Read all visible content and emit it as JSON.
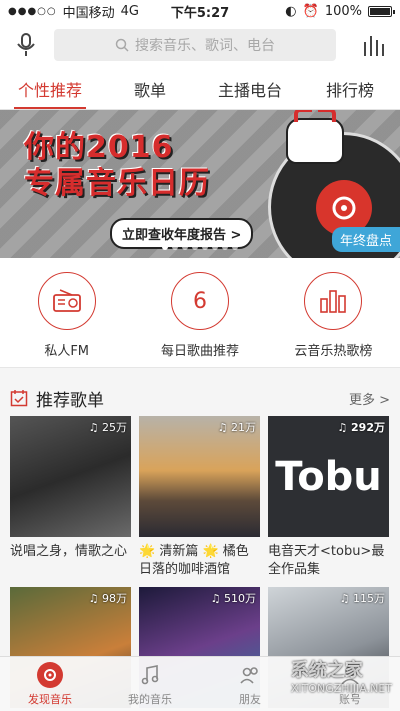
{
  "status": {
    "carrier": "中国移动",
    "network": "4G",
    "time": "下午5:27",
    "battery": "100%"
  },
  "search": {
    "placeholder": "搜索音乐、歌词、电台"
  },
  "tabs": [
    {
      "label": "个性推荐"
    },
    {
      "label": "歌单"
    },
    {
      "label": "主播电台"
    },
    {
      "label": "排行榜"
    }
  ],
  "banner": {
    "line1": "你的2016",
    "line2": "专属音乐日历",
    "button": "立即查收年度报告 >",
    "badge": "年终盘点"
  },
  "quick": [
    {
      "label": "私人FM",
      "icon": "radio-icon"
    },
    {
      "label": "每日歌曲推荐",
      "value": "6",
      "icon": "calendar-icon"
    },
    {
      "label": "云音乐热歌榜",
      "icon": "bar-chart-icon"
    }
  ],
  "section": {
    "title": "推荐歌单",
    "more": "更多 >"
  },
  "playlists": [
    {
      "count": "25万",
      "title": "说唱之身，情歌之心"
    },
    {
      "count": "21万",
      "title": "🌟 清新篇 🌟 橘色日落的咖啡酒馆"
    },
    {
      "count": "292万",
      "title": "电音天才<tobu>最全作品集",
      "cover_text": "Tobu"
    },
    {
      "count": "98万",
      "title": ""
    },
    {
      "count": "510万",
      "title": ""
    },
    {
      "count": "115万",
      "title": ""
    }
  ],
  "bottom_nav": [
    {
      "label": "发现音乐"
    },
    {
      "label": "我的音乐"
    },
    {
      "label": "朋友"
    },
    {
      "label": "账号"
    }
  ],
  "watermark": {
    "main": "系统之家",
    "sub": "XITONGZHIJIA.NET"
  },
  "colors": {
    "accent": "#d33a31",
    "background": "#f5f5f5"
  }
}
